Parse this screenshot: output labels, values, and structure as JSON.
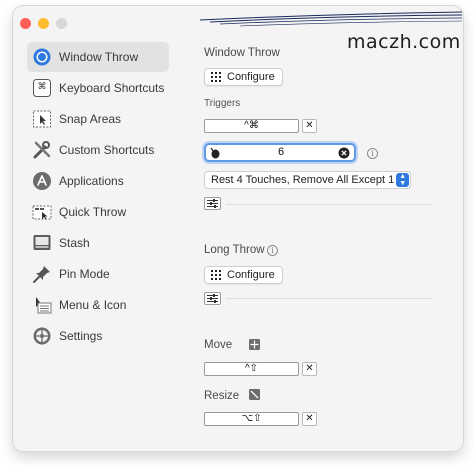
{
  "watermark": "maczh.com",
  "sidebar": {
    "items": [
      {
        "label": "Window Throw",
        "icon": "window-throw-icon",
        "active": true
      },
      {
        "label": "Keyboard Shortcuts",
        "icon": "command-key-icon"
      },
      {
        "label": "Snap Areas",
        "icon": "snap-area-icon"
      },
      {
        "label": "Custom Shortcuts",
        "icon": "tools-icon"
      },
      {
        "label": "Applications",
        "icon": "app-store-icon"
      },
      {
        "label": "Quick Throw",
        "icon": "quick-throw-icon"
      },
      {
        "label": "Stash",
        "icon": "stash-icon"
      },
      {
        "label": "Pin Mode",
        "icon": "pin-icon"
      },
      {
        "label": "Menu & Icon",
        "icon": "menu-icon"
      },
      {
        "label": "Settings",
        "icon": "gear-icon"
      }
    ]
  },
  "main": {
    "window_throw": {
      "title": "Window Throw",
      "configure_label": "Configure",
      "triggers_label": "Triggers",
      "keyboard_shortcut": "^⌘",
      "clear_label": "✕",
      "touch_count": "6",
      "action_select": "Rest 4 Touches, Remove All Except 1"
    },
    "long_throw": {
      "title": "Long Throw",
      "configure_label": "Configure"
    },
    "move": {
      "label": "Move",
      "shortcut": "^⇧",
      "clear_label": "✕"
    },
    "resize": {
      "label": "Resize",
      "shortcut": "⌥⇧",
      "clear_label": "✕"
    }
  },
  "colors": {
    "accent": "#2d79e0",
    "focus_ring": "#5e9ae6",
    "close": "#fe5f57",
    "minimize": "#febc2e"
  }
}
